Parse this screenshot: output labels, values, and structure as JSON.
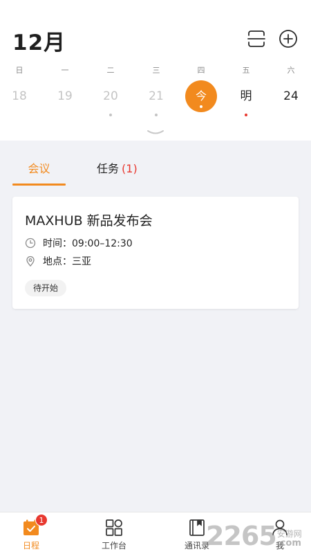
{
  "header": {
    "month": "12月",
    "weekdays": [
      "日",
      "一",
      "二",
      "三",
      "四",
      "五",
      "六"
    ],
    "dates": [
      {
        "label": "18"
      },
      {
        "label": "19"
      },
      {
        "label": "20"
      },
      {
        "label": "21"
      },
      {
        "label": "今"
      },
      {
        "label": "明"
      },
      {
        "label": "24"
      }
    ],
    "icons": {
      "scan": "scan-icon",
      "add": "plus-circle-icon",
      "collapse": "chevron-down-icon"
    }
  },
  "tabs": {
    "meeting": "会议",
    "task": "任务",
    "task_count": "(1)"
  },
  "meeting_card": {
    "title": "MAXHUB 新品发布会",
    "time": "时间：09:00–12:30",
    "location": "地点：三亚",
    "status": "待开始"
  },
  "bottom_nav": {
    "schedule": {
      "label": "日程",
      "badge": "1"
    },
    "workbench": {
      "label": "工作台"
    },
    "contacts": {
      "label": "通讯录"
    },
    "me": {
      "label": "我"
    }
  },
  "watermark": {
    "number": "2265",
    "site": "安游网",
    "domain": ".com"
  },
  "colors": {
    "accent": "#f28a1e",
    "alert": "#e8382f",
    "background": "#f1f2f6"
  }
}
